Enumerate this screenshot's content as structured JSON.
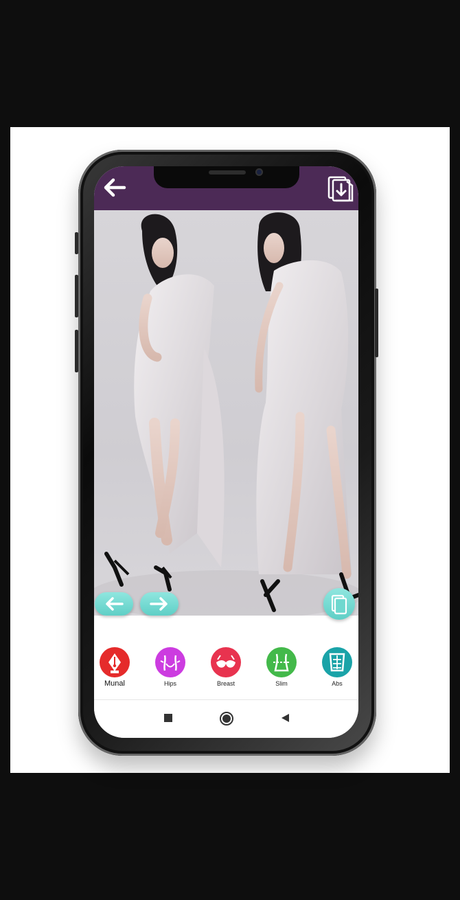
{
  "topbar": {
    "background": "#4c2a56",
    "back_icon": "arrow-left-icon",
    "save_icon": "download-gallery-icon"
  },
  "photo": {
    "description_icon": "photo-preview",
    "prev_icon": "arrow-left-icon",
    "next_icon": "arrow-right-icon",
    "copy_icon": "copy-pages-icon",
    "button_color": "#6fd8cf"
  },
  "tools": [
    {
      "label": "Munal",
      "icon": "pen-nib-icon",
      "color": "#e52b2b"
    },
    {
      "label": "Hips",
      "icon": "hips-icon",
      "color": "#cc3ce0"
    },
    {
      "label": "Breast",
      "icon": "bra-icon",
      "color": "#e8334f"
    },
    {
      "label": "Slim",
      "icon": "waist-icon",
      "color": "#43b94a"
    },
    {
      "label": "Abs",
      "icon": "torso-icon",
      "color": "#1aa3a8"
    }
  ],
  "system_nav": {
    "recents_icon": "square-icon",
    "home_icon": "circle-icon",
    "back_icon": "triangle-left-icon"
  }
}
